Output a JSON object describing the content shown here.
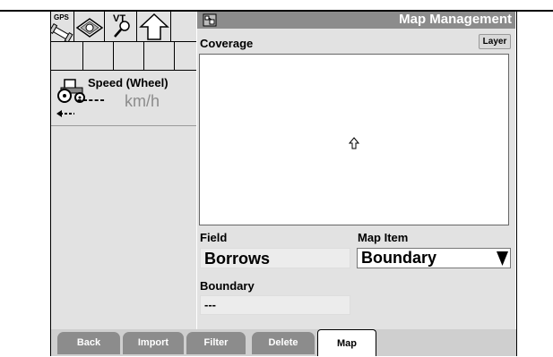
{
  "left_panel": {
    "icons": [
      {
        "name": "gps-icon",
        "label": "GPS"
      },
      {
        "name": "book-icon"
      },
      {
        "name": "vt-search-icon",
        "label": "VT"
      },
      {
        "name": "up-arrow-icon"
      }
    ],
    "speed": {
      "label": "Speed (Wheel)",
      "value": "-----",
      "unit": "km/h"
    }
  },
  "main": {
    "title": "Map Management",
    "coverage_label": "Coverage",
    "layer_button": "Layer",
    "field": {
      "label": "Field",
      "value": "Borrows"
    },
    "map_item": {
      "label": "Map Item",
      "value": "Boundary"
    },
    "boundary": {
      "label": "Boundary",
      "value": "---"
    }
  },
  "tabs": [
    {
      "label": "Back",
      "active": false
    },
    {
      "label": "Import",
      "active": false
    },
    {
      "label": "Filter",
      "active": false
    },
    {
      "label": "Delete",
      "active": false
    },
    {
      "label": "Map",
      "active": true
    }
  ],
  "colors": {
    "header": "#8c8c8c",
    "panel": "#e2e2e2",
    "tab": "#8c8c8c"
  }
}
